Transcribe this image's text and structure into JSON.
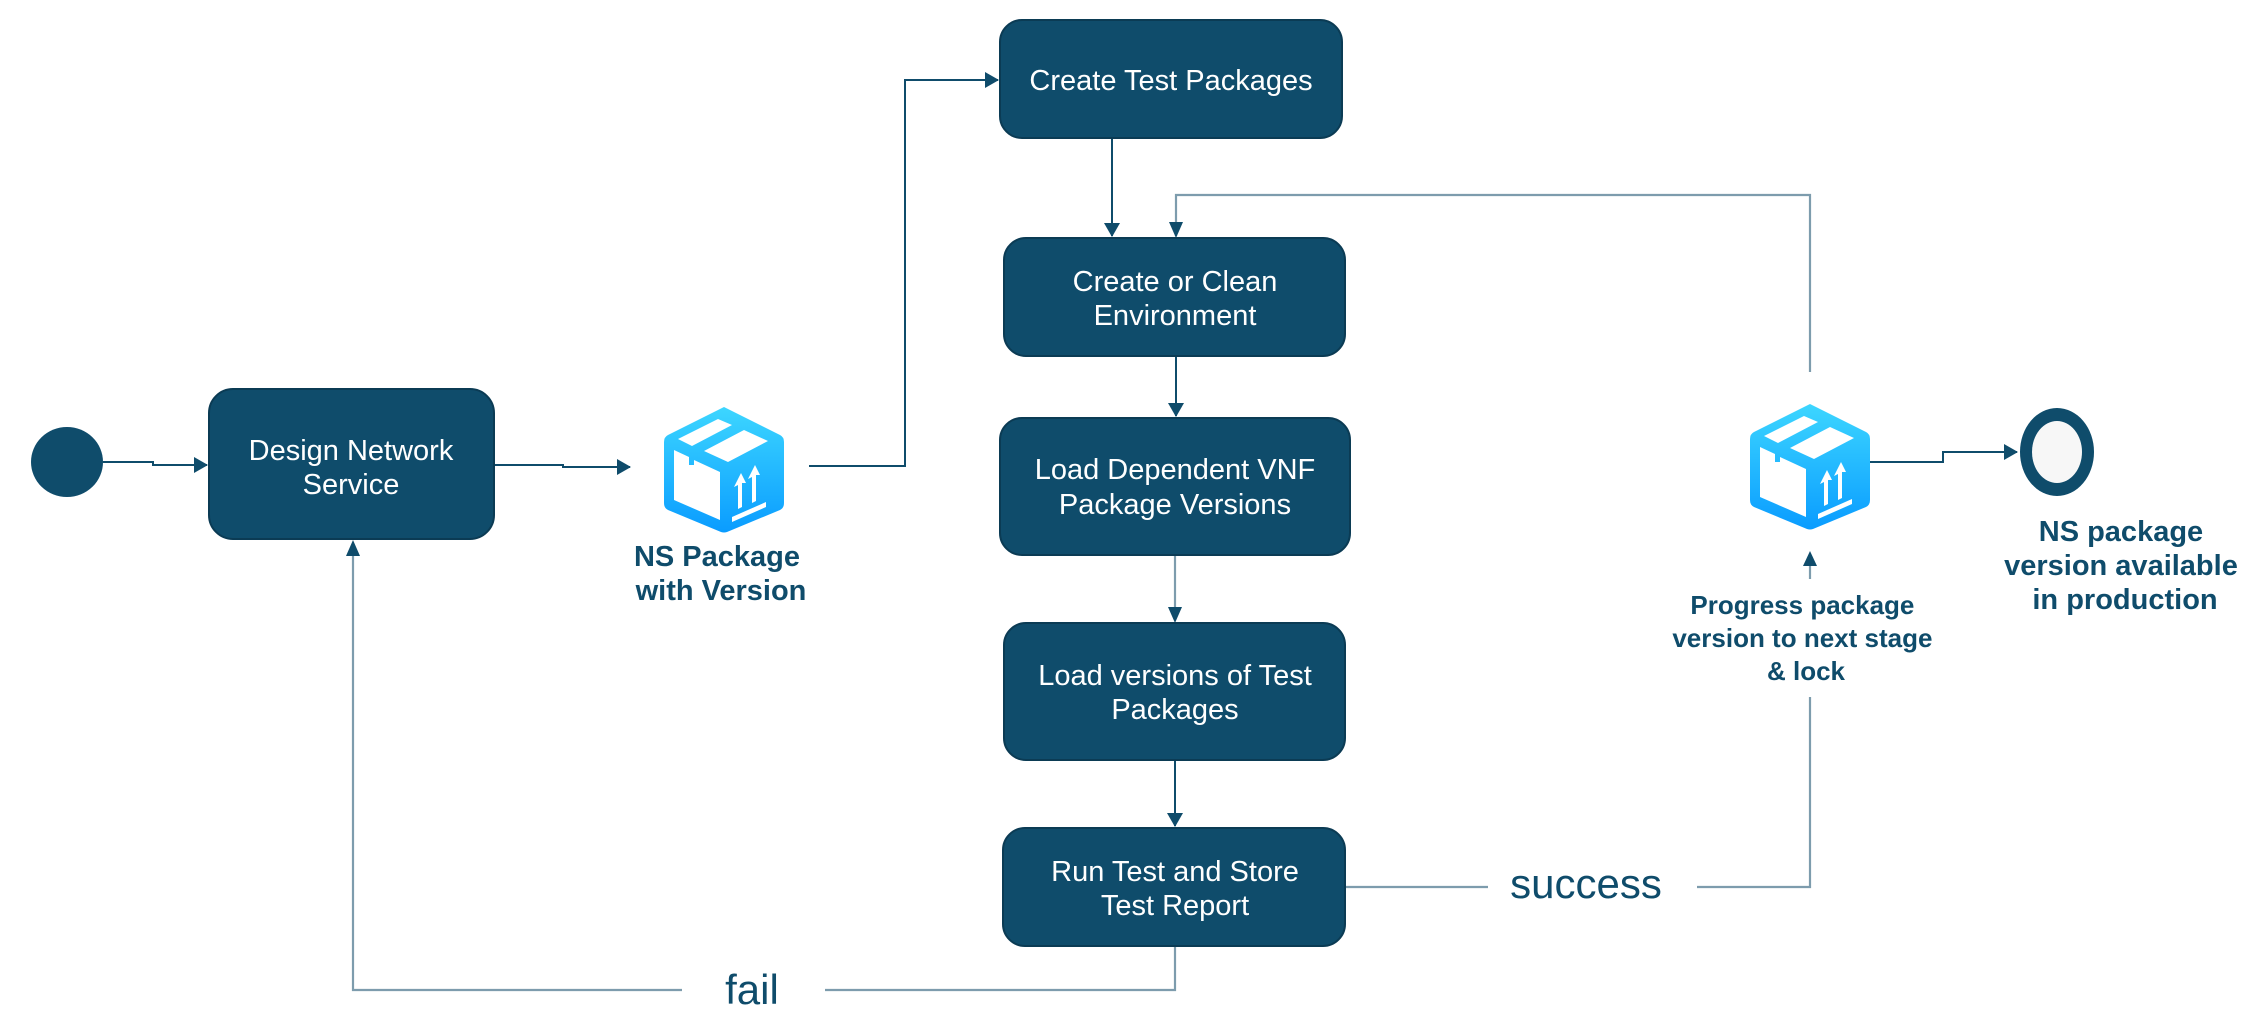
{
  "diagram": {
    "type": "activity-flow",
    "colors": {
      "node_fill": "#0f4c6b",
      "node_text": "#ffffff",
      "connector": "#0f4c6b",
      "connector_light": "#7d9cad",
      "label_text": "#0f4c6b",
      "icon_gradient_top": "#3dd6ff",
      "icon_gradient_bottom": "#0a9cff",
      "end_inner": "#f7f7f7"
    },
    "start": {
      "label": "start"
    },
    "nodes": {
      "design": {
        "lines": [
          "Design Network",
          "Service"
        ]
      },
      "create_test": {
        "lines": [
          "Create Test Packages"
        ]
      },
      "create_env": {
        "lines": [
          "Create or Clean",
          "Environment"
        ]
      },
      "load_vnf": {
        "lines": [
          "Load Dependent VNF",
          "Package Versions"
        ]
      },
      "load_test": {
        "lines": [
          "Load versions of Test",
          "Packages"
        ]
      },
      "run_test": {
        "lines": [
          "Run Test and Store",
          "Test Report"
        ]
      }
    },
    "artifacts": {
      "ns_package": {
        "icon": "package-box-icon",
        "lines": [
          "NS Package",
          "with Version"
        ]
      },
      "progress": {
        "icon": "package-box-icon",
        "lines": [
          "Progress package",
          "version to next stage",
          "& lock"
        ]
      }
    },
    "end": {
      "lines": [
        "NS package",
        "version available",
        "in production"
      ]
    },
    "edges": {
      "success": "success",
      "fail": "fail"
    }
  }
}
